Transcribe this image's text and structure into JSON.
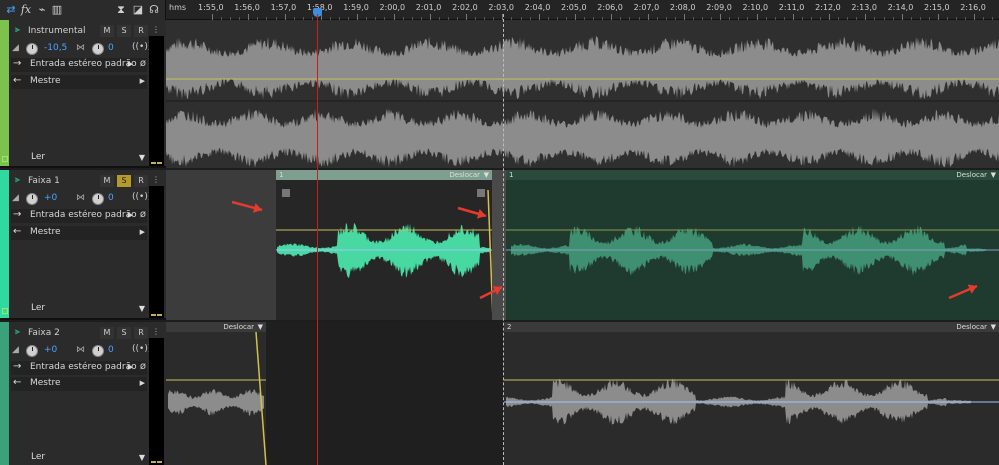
{
  "toolbar": {
    "icons": [
      "loop-icon",
      "fx-icon",
      "automation-icon",
      "meter-icon",
      "metronome-icon",
      "snap-icon",
      "headphones-icon"
    ],
    "fx_label": "fx"
  },
  "ruler": {
    "unit": "hms",
    "labels": [
      "1:55,0",
      "1:56,0",
      "1:57,0",
      "1:58,0",
      "1:59,0",
      "2:00,0",
      "2:01,0",
      "2:02,0",
      "2:03,0",
      "2:04,0",
      "2:05,0",
      "2:06,0",
      "2:07,0",
      "2:08,0",
      "2:09,0",
      "2:10,0",
      "2:11,0",
      "2:12,0",
      "2:13,0",
      "2:14,0",
      "2:15,0",
      "2:16,0"
    ]
  },
  "tracks": [
    {
      "name": "Instrumental",
      "m": "M",
      "s": "S",
      "r": "R",
      "solo_on": false,
      "volume": "-10,5",
      "pan": "0",
      "input": "Entrada estéreo padrão",
      "output": "Mestre",
      "read": "Ler",
      "color": "#7dc24c"
    },
    {
      "name": "Faixa 1",
      "m": "M",
      "s": "S",
      "r": "R",
      "solo_on": true,
      "volume": "+0",
      "pan": "0",
      "input": "Entrada estéreo padrão",
      "output": "Mestre",
      "read": "Ler",
      "color": "#2fd9a0",
      "clips": [
        {
          "number": "1",
          "mode": "Deslocar"
        },
        {
          "number": "1",
          "mode": "Deslocar"
        }
      ]
    },
    {
      "name": "Faixa 2",
      "m": "M",
      "s": "S",
      "r": "R",
      "solo_on": false,
      "volume": "+0",
      "pan": "0",
      "input": "Entrada estéreo padrão",
      "output": "Mestre",
      "read": "Ler",
      "color": "#3aa27a",
      "clips": [
        {
          "number": "",
          "mode": "Deslocar"
        },
        {
          "number": "2",
          "mode": "Deslocar"
        }
      ]
    }
  ],
  "colors": {
    "playhead": "#c2221c",
    "annotation_arrow": "#e33b2e",
    "waveform_grey": "#8c8c8c",
    "waveform_green": "#48d9a2",
    "waveform_green_dim": "#3f8f71",
    "envelope_yellow": "#c8c060",
    "accent_blue": "#4aa3ff"
  }
}
